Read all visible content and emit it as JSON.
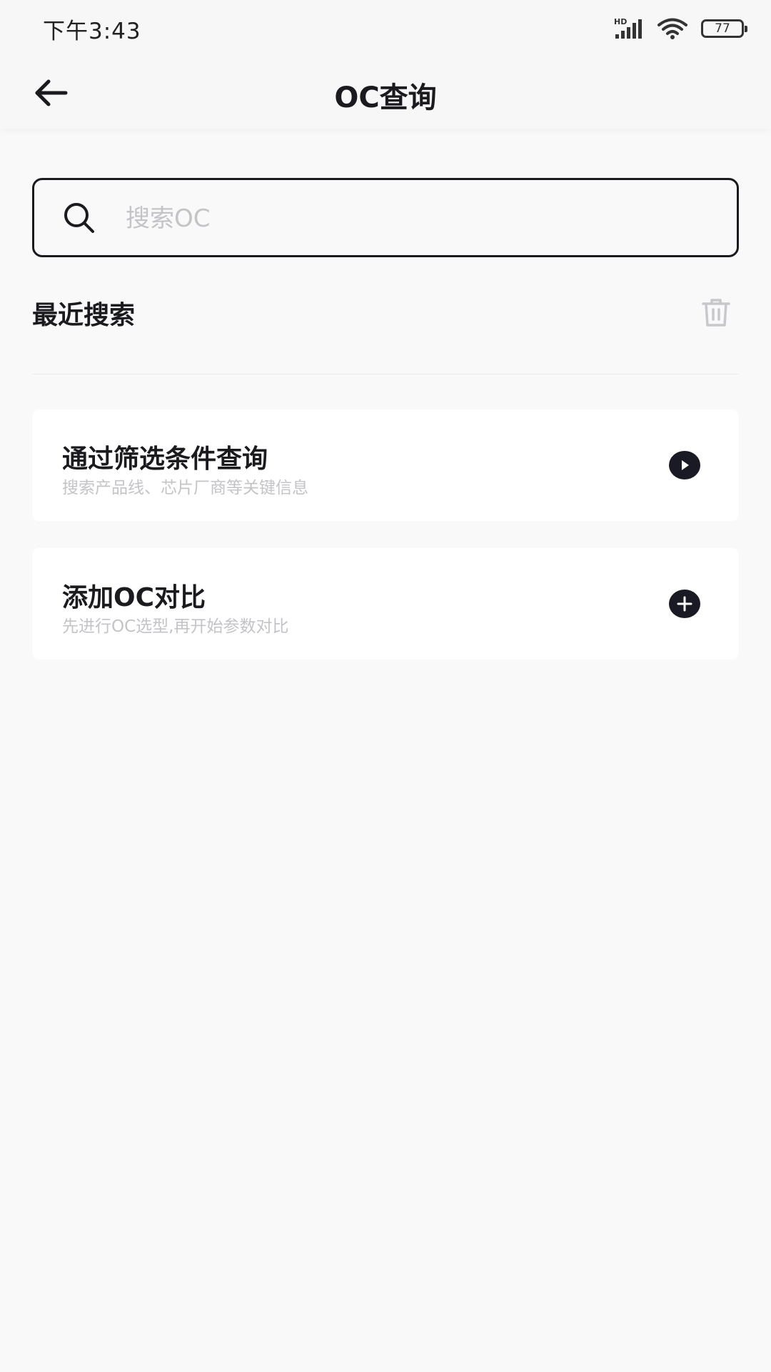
{
  "status_bar": {
    "time": "下午3:43",
    "network_label": "HD",
    "battery_level": "77",
    "icons": [
      "signal-icon",
      "wifi-icon",
      "battery-icon"
    ]
  },
  "header": {
    "title": "OC查询",
    "back_icon": "back-arrow-icon"
  },
  "search": {
    "placeholder": "搜索OC",
    "value": "",
    "icon": "search-icon"
  },
  "recent": {
    "title": "最近搜索",
    "clear_icon": "trash-icon",
    "items": []
  },
  "cards": [
    {
      "title": "通过筛选条件查询",
      "subtitle": "搜索产品线、芯片厂商等关键信息",
      "icon": "play-circle-icon"
    },
    {
      "title": "添加OC对比",
      "subtitle": "先进行OC选型,再开始参数对比",
      "icon": "plus-circle-icon"
    }
  ],
  "colors": {
    "background": "#f9f9f9",
    "text_primary": "#1a1a1f",
    "text_placeholder": "#c4c4c8",
    "card_background": "#ffffff",
    "icon_disabled": "#c8c8cc"
  }
}
